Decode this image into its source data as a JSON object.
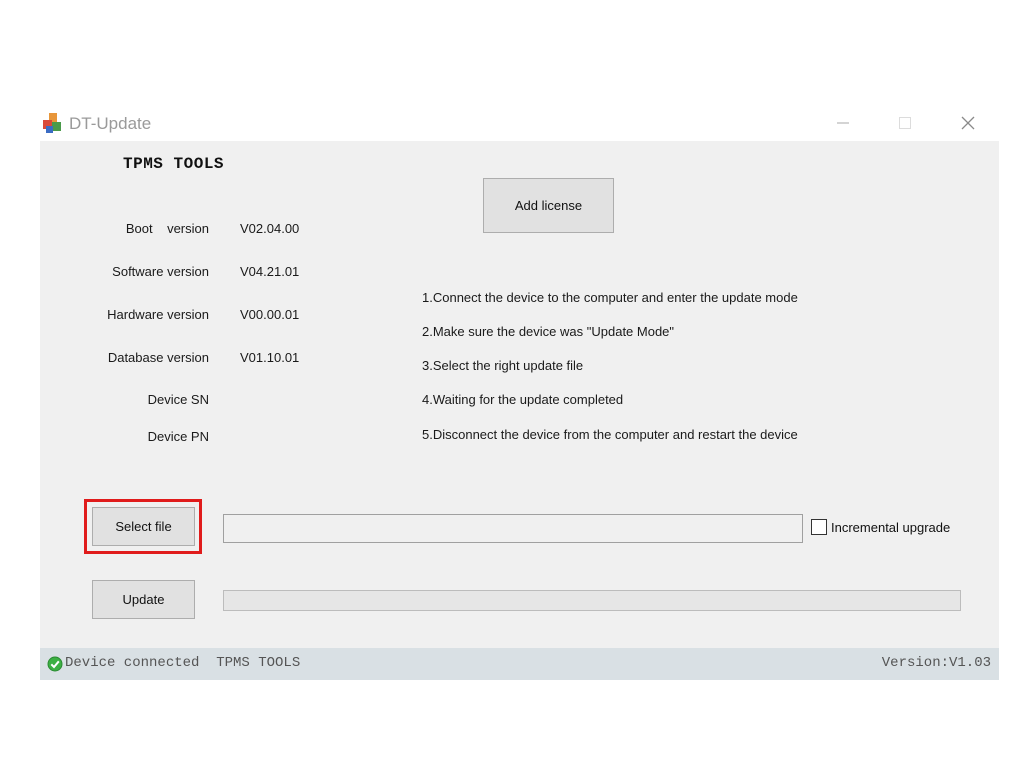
{
  "window": {
    "title": "DT-Update",
    "icon": "app-update-icon",
    "controls": {
      "minimize_icon": "minimize-icon",
      "maximize_icon": "maximize-icon",
      "close_icon": "close-icon"
    }
  },
  "header": {
    "title": "TPMS TOOLS"
  },
  "info": {
    "boot_label": "Boot    version",
    "boot_value": "V02.04.00",
    "software_label": "Software version",
    "software_value": "V04.21.01",
    "hardware_label": "Hardware version",
    "hardware_value": "V00.00.01",
    "database_label": "Database version",
    "database_value": "V01.10.01",
    "device_sn_label": "Device SN",
    "device_sn_value": "",
    "device_pn_label": "Device PN",
    "device_pn_value": ""
  },
  "actions": {
    "add_license_label": "Add license",
    "select_file_label": "Select file",
    "update_label": "Update",
    "file_path_value": "",
    "incremental_label": "Incremental upgrade",
    "incremental_checked": false,
    "progress_percent": 0
  },
  "steps": [
    "1.Connect the device to the computer and enter the update mode",
    "2.Make sure the device was \"Update Mode\"",
    "3.Select the right update file",
    "4.Waiting for the update completed",
    "5.Disconnect the device from the computer and restart the device"
  ],
  "status": {
    "icon": "check-circle-icon",
    "icon_color": "#3cb043",
    "text": "Device connected  TPMS TOOLS",
    "version": "Version:V1.03"
  },
  "colors": {
    "highlight": "#e01b1b",
    "client_bg": "#f0f0f0",
    "statusbar_bg": "#d9e0e4"
  }
}
